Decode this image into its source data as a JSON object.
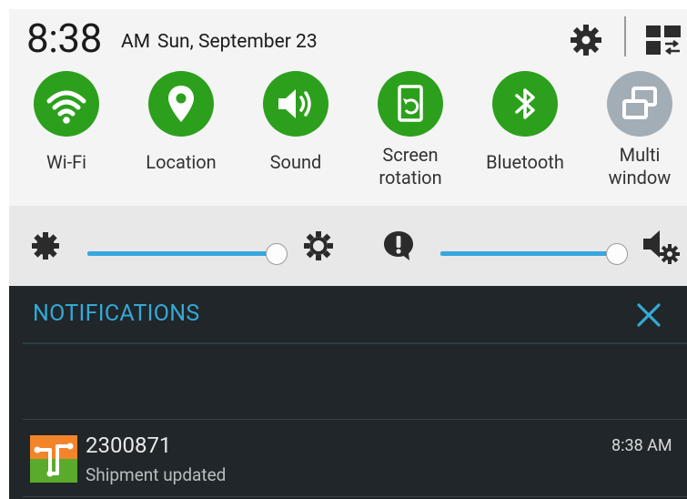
{
  "status": {
    "time": "8:38",
    "ampm": "AM",
    "date": "Sun, September 23"
  },
  "quick_settings": [
    {
      "label": "Wi-Fi",
      "icon": "wifi-icon",
      "state": "on"
    },
    {
      "label": "Location",
      "icon": "location-pin-icon",
      "state": "on"
    },
    {
      "label": "Sound",
      "icon": "speaker-icon",
      "state": "on"
    },
    {
      "label": "Screen rotation",
      "line1": "Screen",
      "line2": "rotation",
      "icon": "screen-rotation-icon",
      "state": "on"
    },
    {
      "label": "Bluetooth",
      "icon": "bluetooth-icon",
      "state": "on"
    },
    {
      "label": "Multi window",
      "line1": "Multi",
      "line2": "window",
      "icon": "multi-window-icon",
      "state": "off"
    }
  ],
  "sliders": {
    "brightness_level": 1.0,
    "volume_level": 1.0
  },
  "notifications": {
    "header": "NOTIFICATIONS",
    "items": [
      {
        "title": "2300871",
        "subtitle": "Shipment updated",
        "time": "8:38 AM",
        "icon": "shipment-app-icon"
      }
    ]
  },
  "colors": {
    "toggle_on": "#2ca01c",
    "toggle_off": "#a3adb6",
    "accent": "#37a7de",
    "notification_bg": "#20262a",
    "header_text": "#35a9d4"
  }
}
